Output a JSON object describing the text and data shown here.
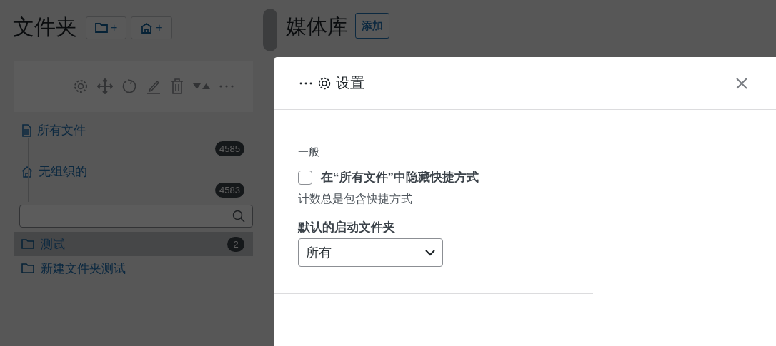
{
  "folders_panel": {
    "title": "文件夹",
    "buttons": [
      {
        "kind": "folder",
        "label": "+"
      },
      {
        "kind": "shortcut",
        "label": "+"
      }
    ],
    "tree": [
      {
        "kind": "all",
        "label": "所有文件",
        "count": "4585"
      },
      {
        "kind": "unorganized",
        "label": "无组织的",
        "count": "4583"
      }
    ],
    "folders": [
      {
        "label": "测试",
        "count": "2",
        "selected": true
      },
      {
        "label": "新建文件夹测试",
        "selected": false
      }
    ]
  },
  "media": {
    "title": "媒体库",
    "add_button": "添加"
  },
  "modal": {
    "title": "设置",
    "section": "一般",
    "checkbox": {
      "label": "在“所有文件”中隐藏快捷方式",
      "checked": false
    },
    "help": "计数总是包含快捷方式",
    "select": {
      "label": "默认的启动文件夹",
      "value": "所有"
    }
  }
}
